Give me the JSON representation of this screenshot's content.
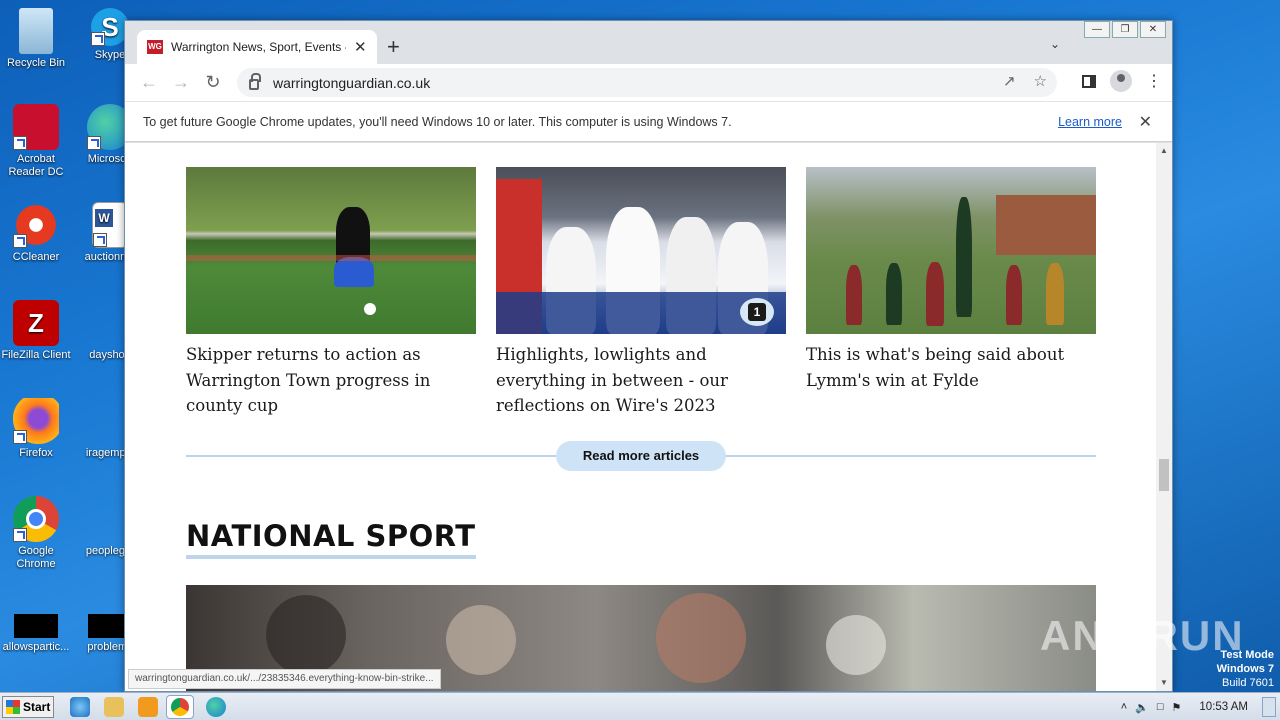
{
  "desktop": {
    "icons": [
      {
        "label": "Recycle Bin",
        "name": "recycle-bin-icon"
      },
      {
        "label": "Skype",
        "name": "skype-icon"
      },
      {
        "label": "Acrobat Reader DC",
        "name": "acrobat-icon"
      },
      {
        "label": "Microsoft",
        "name": "edge-desktop-icon"
      },
      {
        "label": "CCleaner",
        "name": "ccleaner-icon"
      },
      {
        "label": "auctionme",
        "name": "word-doc-icon"
      },
      {
        "label": "FileZilla Client",
        "name": "filezilla-icon"
      },
      {
        "label": "dayshop",
        "name": "file-icon"
      },
      {
        "label": "Firefox",
        "name": "firefox-icon"
      },
      {
        "label": "iragemplo",
        "name": "file-icon"
      },
      {
        "label": "Google Chrome",
        "name": "chrome-icon"
      },
      {
        "label": "peopleget",
        "name": "file-icon"
      },
      {
        "label": "allowspartic...",
        "name": "black-file-icon"
      },
      {
        "label": "problems",
        "name": "black-file-icon"
      }
    ]
  },
  "browser": {
    "tab_title": "Warrington News, Sport, Events - W",
    "favicon_text": "WG",
    "url": "warringtonguardian.co.uk",
    "infobar_text": "To get future Google Chrome updates, you'll need Windows 10 or later. This computer is using Windows 7.",
    "infobar_link": "Learn more",
    "status_url": "warringtonguardian.co.uk/.../23835346.everything-know-bin-strike..."
  },
  "page": {
    "articles": [
      {
        "headline": "Skipper returns to action as Warrington Town progress in county cup"
      },
      {
        "headline": "Highlights, lowlights and everything in between - our reflections on Wire's 2023",
        "comments": "1"
      },
      {
        "headline": "This is what's being said about Lymm's win at Fylde"
      }
    ],
    "read_more": "Read more articles",
    "section_title": "NATIONAL SPORT"
  },
  "system": {
    "watermark": "ANY RUN",
    "test_mode": [
      "Test Mode",
      "Windows 7",
      "Build 7601"
    ],
    "start_label": "Start",
    "clock": "10:53 AM"
  },
  "colors": {
    "accent_link": "#1a5cc9",
    "read_more_bg": "#cfe3f6",
    "section_underline": "#bed4ea",
    "brand_red": "#c41e2b"
  }
}
